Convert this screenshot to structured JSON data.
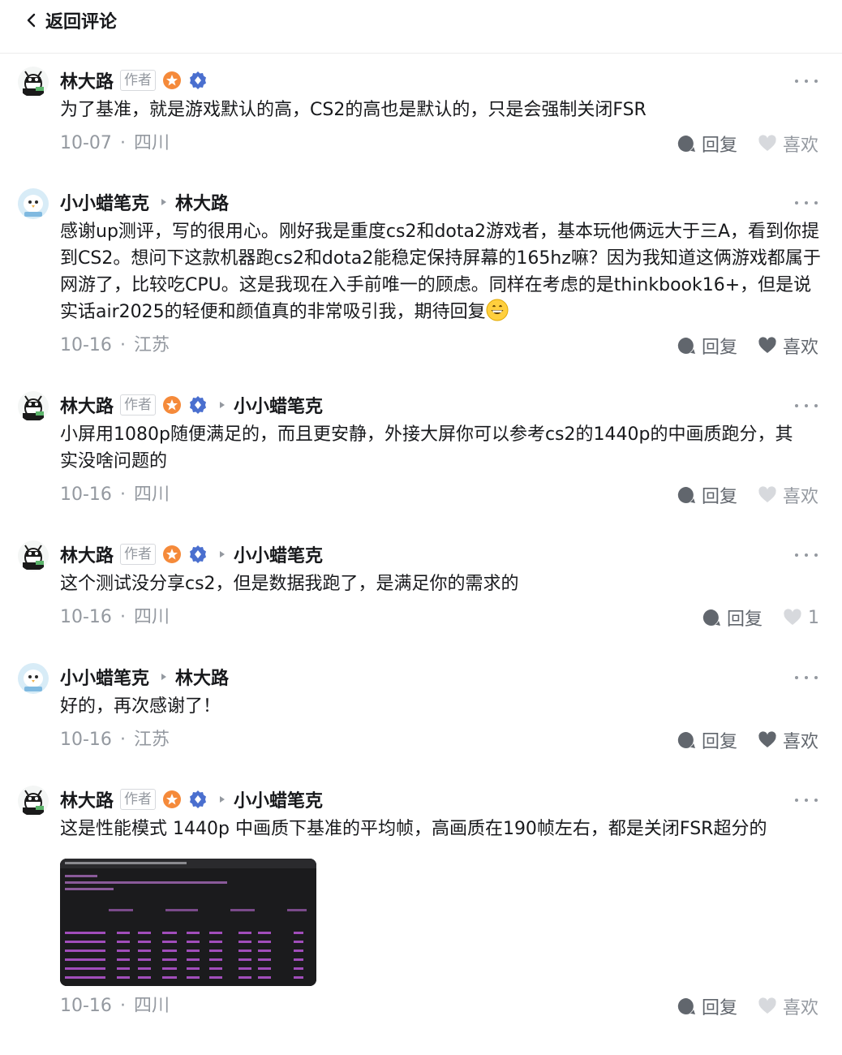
{
  "header": {
    "back_label": "返回评论"
  },
  "comments": [
    {
      "author": "林大路",
      "author_tag": "作者",
      "reply_to": "",
      "text": "为了基准，就是游戏默认的高，CS2的高也是默认的，只是会强制关闭FSR",
      "date": "10-07",
      "separator": "·",
      "location": "四川",
      "reply_label": "回复",
      "like_label": "喜欢",
      "liked": false
    },
    {
      "author": "小小蜡笔克",
      "author_tag": "",
      "reply_to": "林大路",
      "text": "感谢up测评，写的很用心。刚好我是重度cs2和dota2游戏者，基本玩他俩远大于三A，看到你提到CS2。想问下这款机器跑cs2和dota2能稳定保持屏幕的165hz嘛？因为我知道这俩游戏都属于网游了，比较吃CPU。这是我现在入手前唯一的顾虑。同样在考虑的是thinkbook16+，但是说实话air2025的轻便和颜值真的非常吸引我，期待回复",
      "emoji": "grinning-emoji",
      "date": "10-16",
      "separator": "·",
      "location": "江苏",
      "reply_label": "回复",
      "like_label": "喜欢",
      "liked": false
    },
    {
      "author": "林大路",
      "author_tag": "作者",
      "reply_to": "小小蜡笔克",
      "text": "小屏用1080p随便满足的，而且更安静，外接大屏你可以参考cs2的1440p的中画质跑分，其实没啥问题的",
      "date": "10-16",
      "separator": "·",
      "location": "四川",
      "reply_label": "回复",
      "like_label": "喜欢",
      "liked": false
    },
    {
      "author": "林大路",
      "author_tag": "作者",
      "reply_to": "小小蜡笔克",
      "text": "这个测试没分享cs2，但是数据我跑了，是满足你的需求的",
      "date": "10-16",
      "separator": "·",
      "location": "四川",
      "reply_label": "回复",
      "like_label": "1",
      "liked": false
    },
    {
      "author": "小小蜡笔克",
      "author_tag": "",
      "reply_to": "林大路",
      "text": "好的，再次感谢了！",
      "date": "10-16",
      "separator": "·",
      "location": "江苏",
      "reply_label": "回复",
      "like_label": "喜欢",
      "liked": false
    },
    {
      "author": "林大路",
      "author_tag": "作者",
      "reply_to": "小小蜡笔克",
      "text": "这是性能模式 1440p 中画质下基准的平均帧，高画质在190帧左右，都是关闭FSR超分的",
      "has_image": true,
      "date": "10-16",
      "separator": "·",
      "location": "四川",
      "reply_label": "回复",
      "like_label": "喜欢",
      "liked": false
    }
  ],
  "icons": {
    "back": "chevron-left-icon",
    "more": "more-dots-icon",
    "reply": "reply-bubble-icon",
    "like": "heart-icon",
    "badge_level": "orange-level-badge-icon",
    "badge_verify": "blue-verified-badge-icon"
  },
  "colors": {
    "text": "#18191c",
    "secondary": "#9499a0",
    "action": "#61666d",
    "badge_orange": "#f58a3a",
    "badge_blue": "#4a6fcf",
    "terminal_bg": "#1b1b1d",
    "terminal_purple": "#c05cd6"
  }
}
